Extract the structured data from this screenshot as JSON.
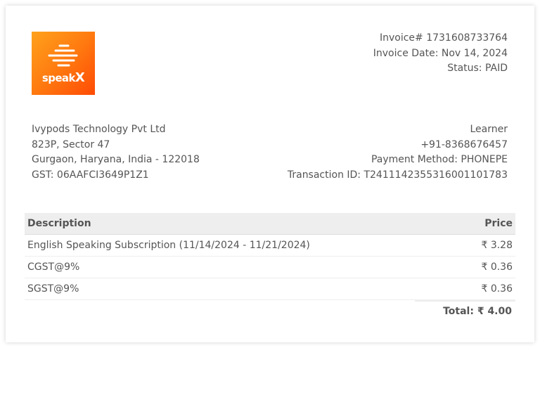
{
  "brand": {
    "logo_text_main": "speak",
    "logo_text_x": "X",
    "gradient_colors": [
      "#ffa21c",
      "#ff7a10",
      "#ff4b05"
    ]
  },
  "invoice": {
    "number_line": "Invoice# 1731608733764",
    "date_line": "Invoice Date: Nov 14, 2024",
    "status_line": "Status: PAID"
  },
  "seller": {
    "name": "Ivypods Technology Pvt Ltd",
    "address_line1": "823P, Sector 47",
    "address_line2": "Gurgaon, Haryana, India - 122018",
    "gst": "GST: 06AAFCI3649P1Z1"
  },
  "buyer": {
    "name": "Learner",
    "phone": "+91-8368676457",
    "payment_method": "Payment Method: PHONEPE",
    "transaction_id": "Transaction ID: T2411142355316001101783"
  },
  "table": {
    "headers": {
      "description": "Description",
      "price": "Price"
    },
    "rows": [
      {
        "description": "English Speaking Subscription (11/14/2024 - 11/21/2024)",
        "price": "₹ 3.28"
      },
      {
        "description": "CGST@9%",
        "price": "₹ 0.36"
      },
      {
        "description": "SGST@9%",
        "price": "₹ 0.36"
      }
    ]
  },
  "total": "Total: ₹ 4.00"
}
